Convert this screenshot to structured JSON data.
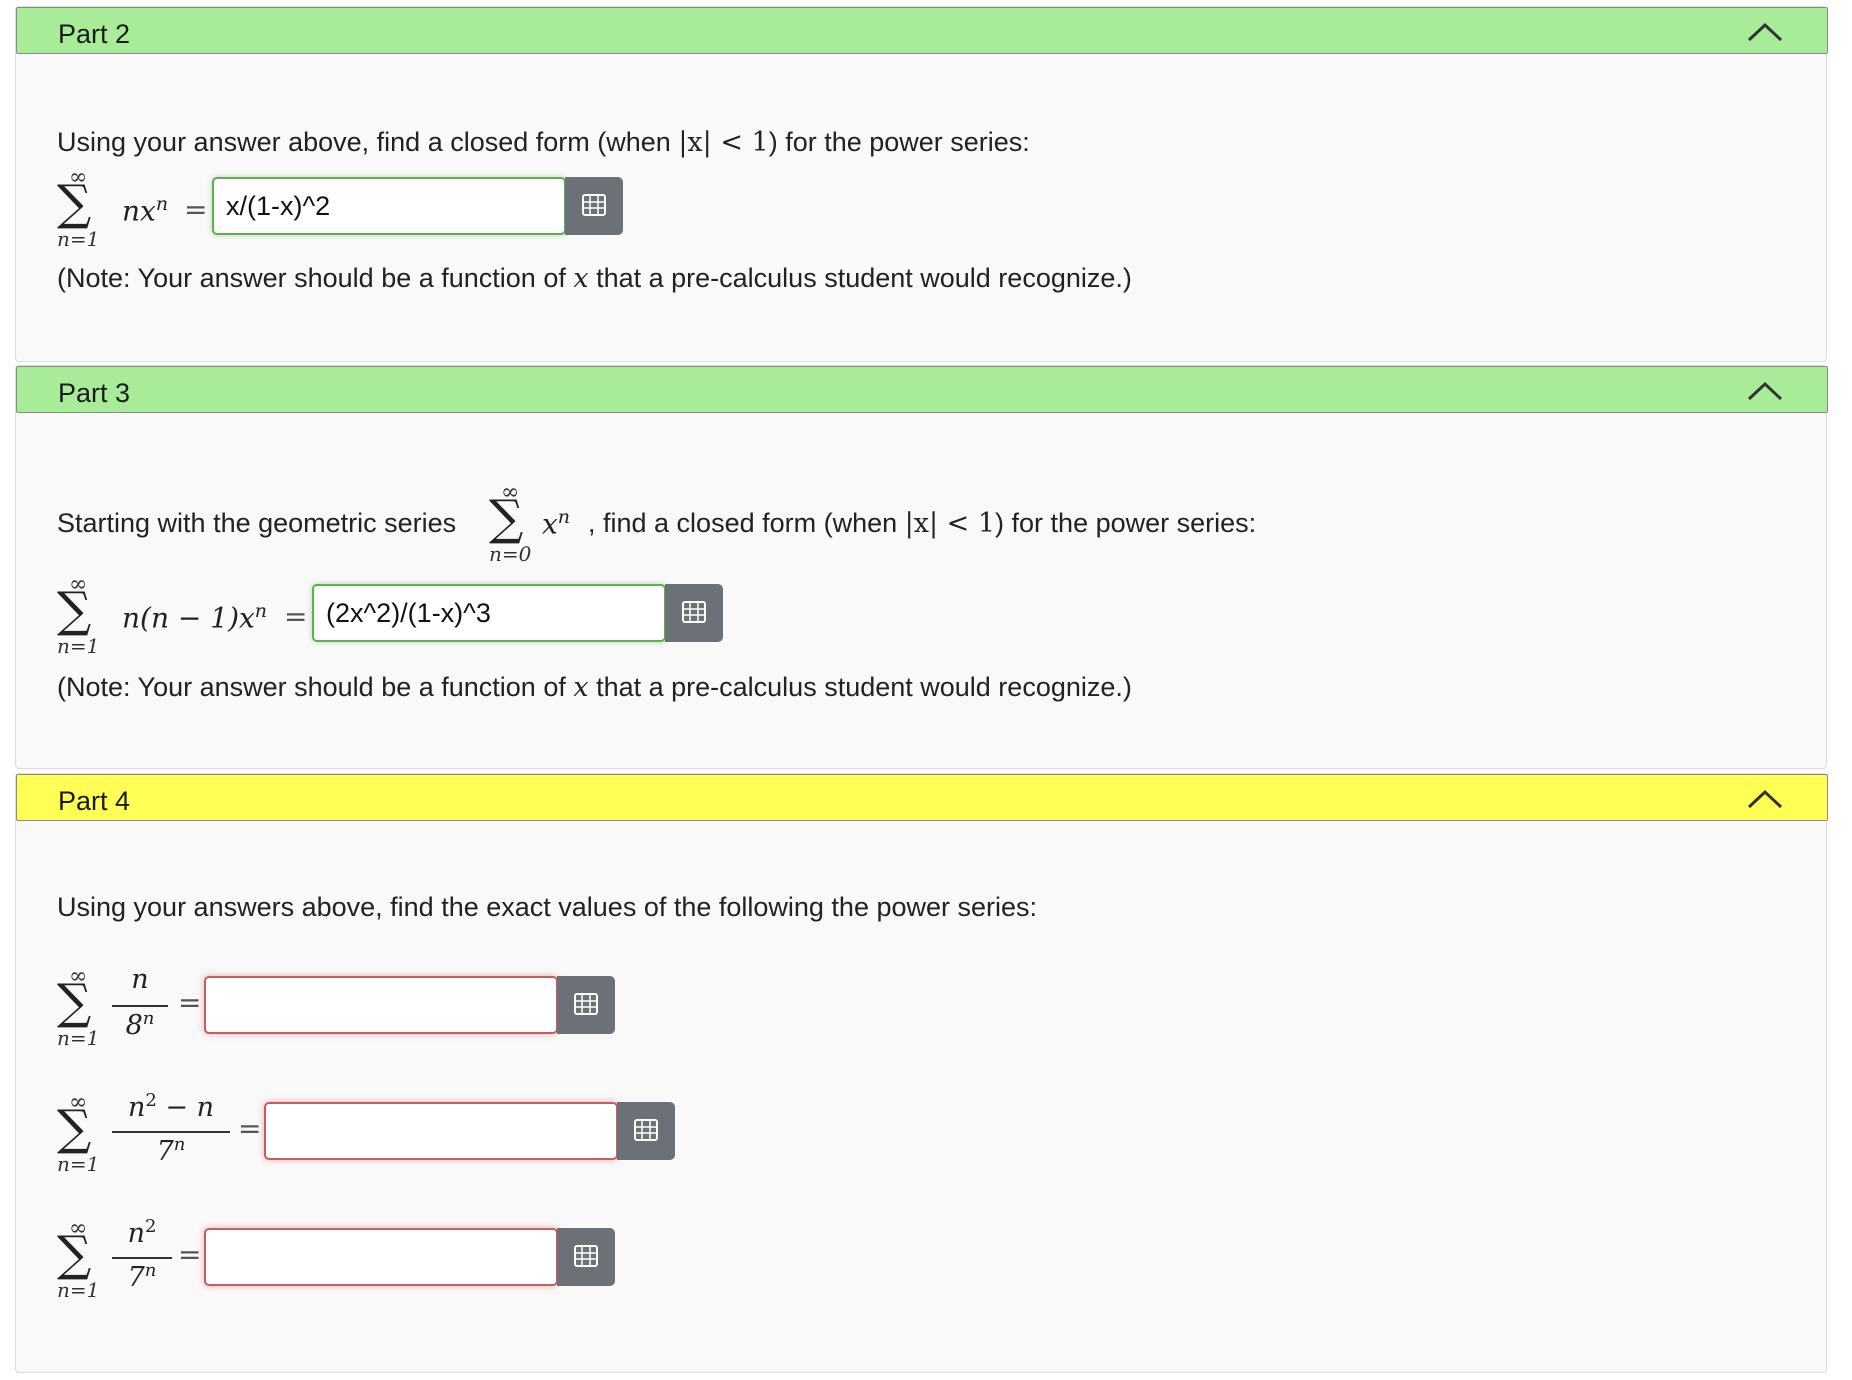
{
  "colors": {
    "correct_header": "#a8ec9a",
    "partial_header": "#ffff55",
    "panel": "#f9f9f9",
    "button": "#6b7177"
  },
  "icons": {
    "collapse": "chevron-up-icon",
    "equation_editor": "equation-editor-icon"
  },
  "part2": {
    "title": "Part 2",
    "intro_a": "Using your answer above, find a closed form (when ",
    "intro_math": "|x| < 1",
    "intro_b": ") for the power series:",
    "sum_upper": "∞",
    "sum_lower": "n=1",
    "term": "nx",
    "term_exp": "n",
    "equals": "=",
    "answer": "x/(1-x)^2",
    "note_a": "(Note: Your answer should be a function of ",
    "note_var": "x",
    "note_b": " that a pre-calculus student would recognize.)"
  },
  "part3": {
    "title": "Part 3",
    "intro_a": "Starting with the geometric series ",
    "geo_upper": "∞",
    "geo_lower": "n=0",
    "geo_term": "x",
    "geo_exp": "n",
    "intro_b": ", find a closed form (when ",
    "intro_math": "|x| < 1",
    "intro_c": ") for the power series:",
    "sum_upper": "∞",
    "sum_lower": "n=1",
    "term": "n(n − 1)x",
    "term_exp": "n",
    "equals": "=",
    "answer": "(2x^2)/(1-x)^3",
    "note_a": "(Note: Your answer should be a function of ",
    "note_var": "x",
    "note_b": " that a pre-calculus student would recognize.)"
  },
  "part4": {
    "title": "Part 4",
    "intro": "Using your answers above, find the exact values of the following the power series:",
    "series": [
      {
        "upper": "∞",
        "lower": "n=1",
        "num": "n",
        "den": "8",
        "den_exp": "n",
        "equals": "=",
        "answer": ""
      },
      {
        "upper": "∞",
        "lower": "n=1",
        "num": "n",
        "num_exp": "2",
        "num_tail": " − n",
        "den": "7",
        "den_exp": "n",
        "equals": "=",
        "answer": ""
      },
      {
        "upper": "∞",
        "lower": "n=1",
        "num": "n",
        "num_exp": "2",
        "den": "7",
        "den_exp": "n",
        "equals": "=",
        "answer": ""
      }
    ]
  }
}
